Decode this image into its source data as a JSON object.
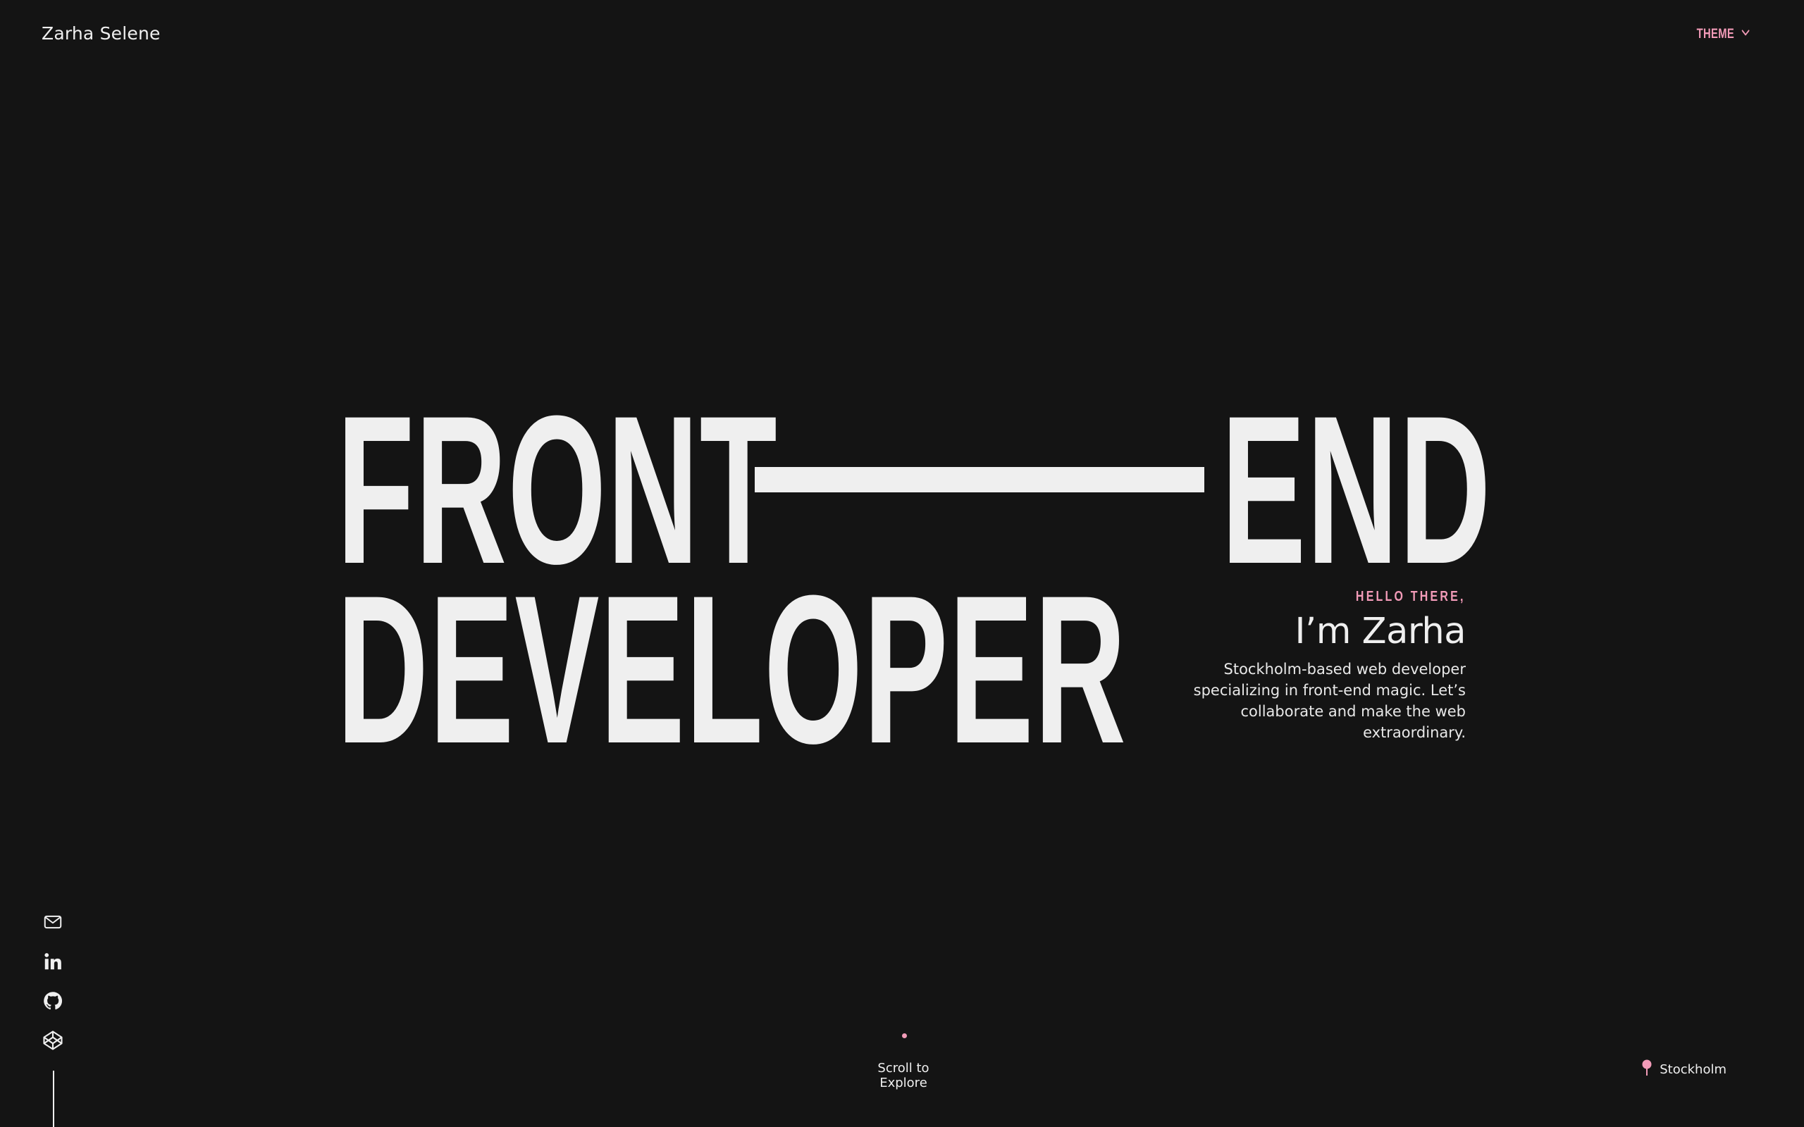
{
  "header": {
    "brand": "Zarha Selene",
    "theme_label": "THEME",
    "theme_icon": "chevron-down-icon"
  },
  "hero": {
    "line1_left": "FRONT",
    "line1_right": "END",
    "line2": "DEVELOPER"
  },
  "intro": {
    "greeting": "HELLO THERE,",
    "name": "I’m Zarha",
    "bio": "Stockholm-based web developer specializing in front-end magic. Let’s collaborate and make the web extraordinary."
  },
  "socials": [
    {
      "icon": "mail-icon"
    },
    {
      "icon": "linkedin-icon"
    },
    {
      "icon": "github-icon"
    },
    {
      "icon": "codepen-icon"
    }
  ],
  "footer": {
    "scroll_label": "Scroll to Explore",
    "location": "Stockholm",
    "location_icon": "map-pin-icon"
  },
  "colors": {
    "background": "#141414",
    "text": "#efefef",
    "accent": "#f29bb8"
  }
}
